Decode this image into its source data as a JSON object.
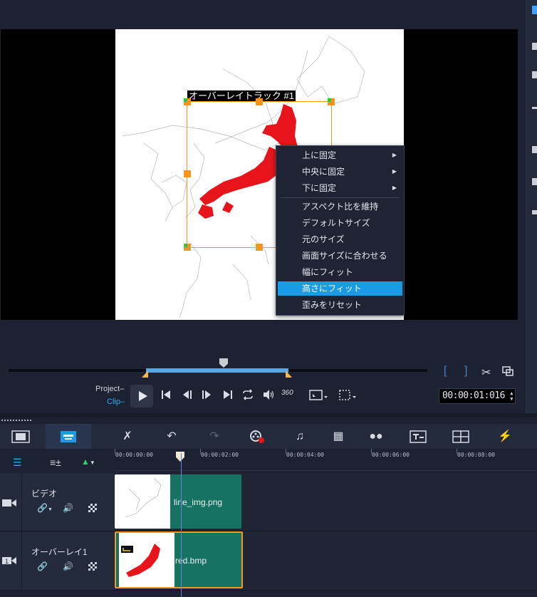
{
  "preview": {
    "overlay_label": "オーバーレイトラック #1"
  },
  "context_menu": {
    "items": [
      {
        "label": "上に固定",
        "submenu": true
      },
      {
        "label": "中央に固定",
        "submenu": true
      },
      {
        "label": "下に固定",
        "submenu": true
      },
      {
        "label": "アスペクト比を維持",
        "submenu": false
      },
      {
        "label": "デフォルトサイズ",
        "submenu": false
      },
      {
        "label": "元のサイズ",
        "submenu": false
      },
      {
        "label": "画面サイズに合わせる",
        "submenu": false
      },
      {
        "label": "幅にフィット",
        "submenu": false
      },
      {
        "label": "高さにフィット",
        "submenu": false,
        "highlighted": true
      },
      {
        "label": "歪みをリセット",
        "submenu": false
      }
    ],
    "submenu_arrow": "▶"
  },
  "player": {
    "project_label": "Project",
    "clip_label": "Clip",
    "timecode": "00:00:01:016",
    "mark_in": "[",
    "mark_out": "]",
    "vr_label": "360"
  },
  "timeline": {
    "ruler_labels": [
      "00:00:00:00",
      "00:00:02:00",
      "00:00:04:00",
      "00:00:06:00",
      "00:00:08:00"
    ],
    "tracks": [
      {
        "name": "ビデオ",
        "clip_name": "line_img.png"
      },
      {
        "name": "オーバーレイ1",
        "clip_name": "red.bmp"
      }
    ]
  },
  "colors": {
    "accent_blue": "#1a9be6",
    "clip_green": "#167363",
    "selection_orange": "#f39a1e",
    "japan_red": "#e8141b"
  },
  "icons": [
    "storyboard-view-icon",
    "timeline-view-icon",
    "tools-icon",
    "undo-icon",
    "redo-icon",
    "record-capture-icon",
    "audio-mixer-icon",
    "auto-music-icon",
    "motion-tracking-icon",
    "subtitle-editor-icon",
    "multicam-icon",
    "motion-icon"
  ]
}
